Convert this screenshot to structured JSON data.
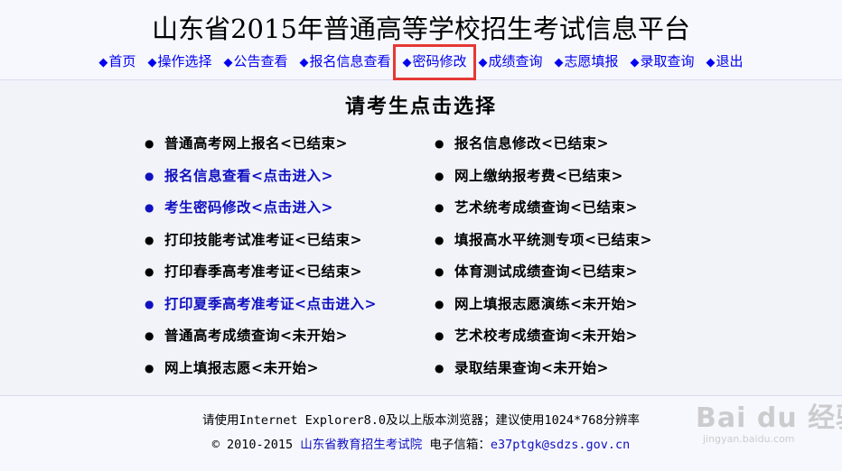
{
  "header": {
    "title": "山东省2015年普通高等学校招生考试信息平台"
  },
  "nav": [
    {
      "label": "首页",
      "highlighted": false
    },
    {
      "label": "操作选择",
      "highlighted": false
    },
    {
      "label": "公告查看",
      "highlighted": false
    },
    {
      "label": "报名信息查看",
      "highlighted": false
    },
    {
      "label": "密码修改",
      "highlighted": true
    },
    {
      "label": "成绩查询",
      "highlighted": false
    },
    {
      "label": "志愿填报",
      "highlighted": false
    },
    {
      "label": "录取查询",
      "highlighted": false
    },
    {
      "label": "退出",
      "highlighted": false
    }
  ],
  "main": {
    "title": "请考生点击选择",
    "left_items": [
      {
        "label": "普通高考网上报名<已结束>",
        "link": false
      },
      {
        "label": "报名信息查看<点击进入>",
        "link": true
      },
      {
        "label": "考生密码修改<点击进入>",
        "link": true
      },
      {
        "label": "打印技能考试准考证<已结束>",
        "link": false
      },
      {
        "label": "打印春季高考准考证<已结束>",
        "link": false
      },
      {
        "label": "打印夏季高考准考证<点击进入>",
        "link": true
      },
      {
        "label": "普通高考成绩查询<未开始>",
        "link": false
      },
      {
        "label": "网上填报志愿<未开始>",
        "link": false
      }
    ],
    "right_items": [
      {
        "label": "报名信息修改<已结束>",
        "link": false
      },
      {
        "label": "网上缴纳报考费<已结束>",
        "link": false
      },
      {
        "label": "艺术统考成绩查询<已结束>",
        "link": false
      },
      {
        "label": "填报高水平统测专项<已结束>",
        "link": false
      },
      {
        "label": "体育测试成绩查询<已结束>",
        "link": false
      },
      {
        "label": "网上填报志愿演练<未开始>",
        "link": false
      },
      {
        "label": "艺术校考成绩查询<未开始>",
        "link": false
      },
      {
        "label": "录取结果查询<未开始>",
        "link": false
      }
    ]
  },
  "footer": {
    "browser_note": "请使用Internet Explorer8.0及以上版本浏览器；建议使用1024*768分辨率",
    "copyright": "© 2010-2015",
    "org_name": "山东省教育招生考试院",
    "email_label": "电子信箱：",
    "email": "e37ptgk@sdzs.gov.cn"
  },
  "watermark": {
    "main": "Bai du 经验",
    "sub": "jingyan.baidu.com"
  },
  "colors": {
    "link": "#1010c0",
    "nav": "#0000ee",
    "highlight_box": "#e53935",
    "background": "#f1f3f9"
  },
  "icons": {
    "nav_marker": "diamond-icon",
    "list_marker": "bullet-icon"
  }
}
